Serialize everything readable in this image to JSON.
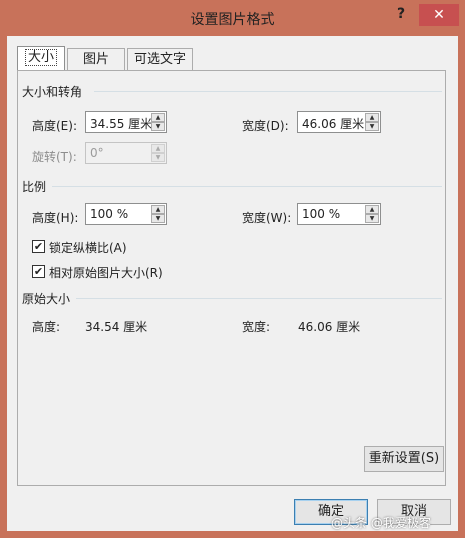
{
  "window": {
    "title": "设置图片格式",
    "help": "?",
    "close": "✕"
  },
  "tabs": [
    {
      "label": "大小"
    },
    {
      "label": "图片"
    },
    {
      "label": "可选文字"
    }
  ],
  "size_rotate": {
    "heading": "大小和转角",
    "height_label": "高度(E):",
    "height_value": "34.55 厘米",
    "width_label": "宽度(D):",
    "width_value": "46.06 厘米",
    "rotate_label": "旋转(T):",
    "rotate_value": "0°"
  },
  "scale": {
    "heading": "比例",
    "height_label": "高度(H):",
    "height_value": "100 %",
    "width_label": "宽度(W):",
    "width_value": "100 %",
    "lock_aspect": {
      "label": "锁定纵横比(A)",
      "checked": true
    },
    "relative_original": {
      "label": "相对原始图片大小(R)",
      "checked": true
    }
  },
  "original": {
    "heading": "原始大小",
    "height_label": "高度:",
    "height_value": "34.54 厘米",
    "width_label": "宽度:",
    "width_value": "46.06 厘米"
  },
  "buttons": {
    "reset": "重新设置(S)",
    "ok": "确定",
    "cancel": "取消"
  },
  "watermark": "@头条 @我爱极客",
  "glyphs": {
    "up": "▲",
    "down": "▼",
    "check": "✔"
  }
}
